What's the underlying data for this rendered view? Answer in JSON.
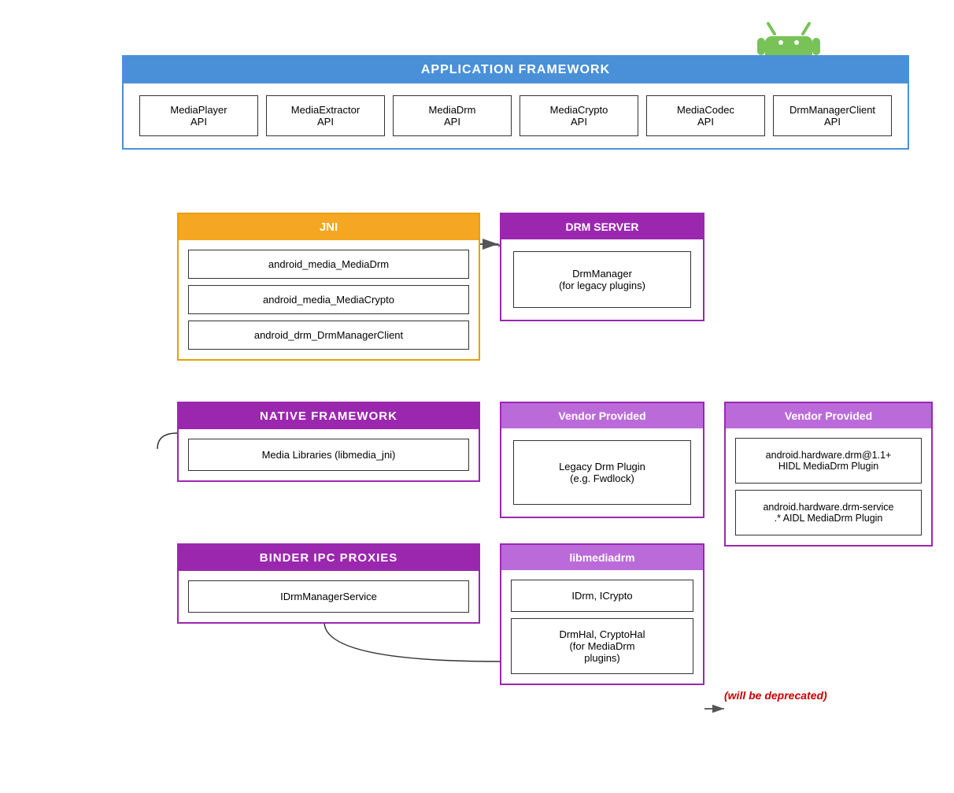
{
  "android_logo": {
    "alt": "Android Logo"
  },
  "app_framework": {
    "header": "APPLICATION FRAMEWORK",
    "apis": [
      {
        "line1": "MediaPlayer",
        "line2": "API"
      },
      {
        "line1": "MediaExtractor",
        "line2": "API"
      },
      {
        "line1": "MediaDrm",
        "line2": "API"
      },
      {
        "line1": "MediaCrypto",
        "line2": "API"
      },
      {
        "line1": "MediaCodec",
        "line2": "API"
      },
      {
        "line1": "DrmManagerClient",
        "line2": "API"
      }
    ]
  },
  "jni": {
    "header": "JNI",
    "items": [
      "android_media_MediaDrm",
      "android_media_MediaCrypto",
      "android_drm_DrmManagerClient"
    ]
  },
  "drm_server": {
    "header": "DRM SERVER",
    "item": "DrmManager\n(for legacy plugins)"
  },
  "native_framework": {
    "header": "NATIVE FRAMEWORK",
    "item": "Media Libraries (libmedia_jni)"
  },
  "vendor1": {
    "header": "Vendor Provided",
    "item": "Legacy Drm Plugin\n(e.g. Fwdlock)"
  },
  "vendor2": {
    "header": "Vendor Provided",
    "items": [
      "android.hardware.drm@1.1+\nHIDL MediaDrm Plugin",
      "android.hardware.drm-service\n.* AIDL MediaDrm Plugin"
    ]
  },
  "binder": {
    "header": "BINDER IPC PROXIES",
    "item": "IDrmManagerService"
  },
  "libmediadrm": {
    "header": "libmediadrm",
    "items": [
      "IDrm, ICrypto",
      "DrmHal, CryptoHal\n(for MediaDrm\nplugins)"
    ]
  },
  "deprecated": "(will be deprecated)"
}
